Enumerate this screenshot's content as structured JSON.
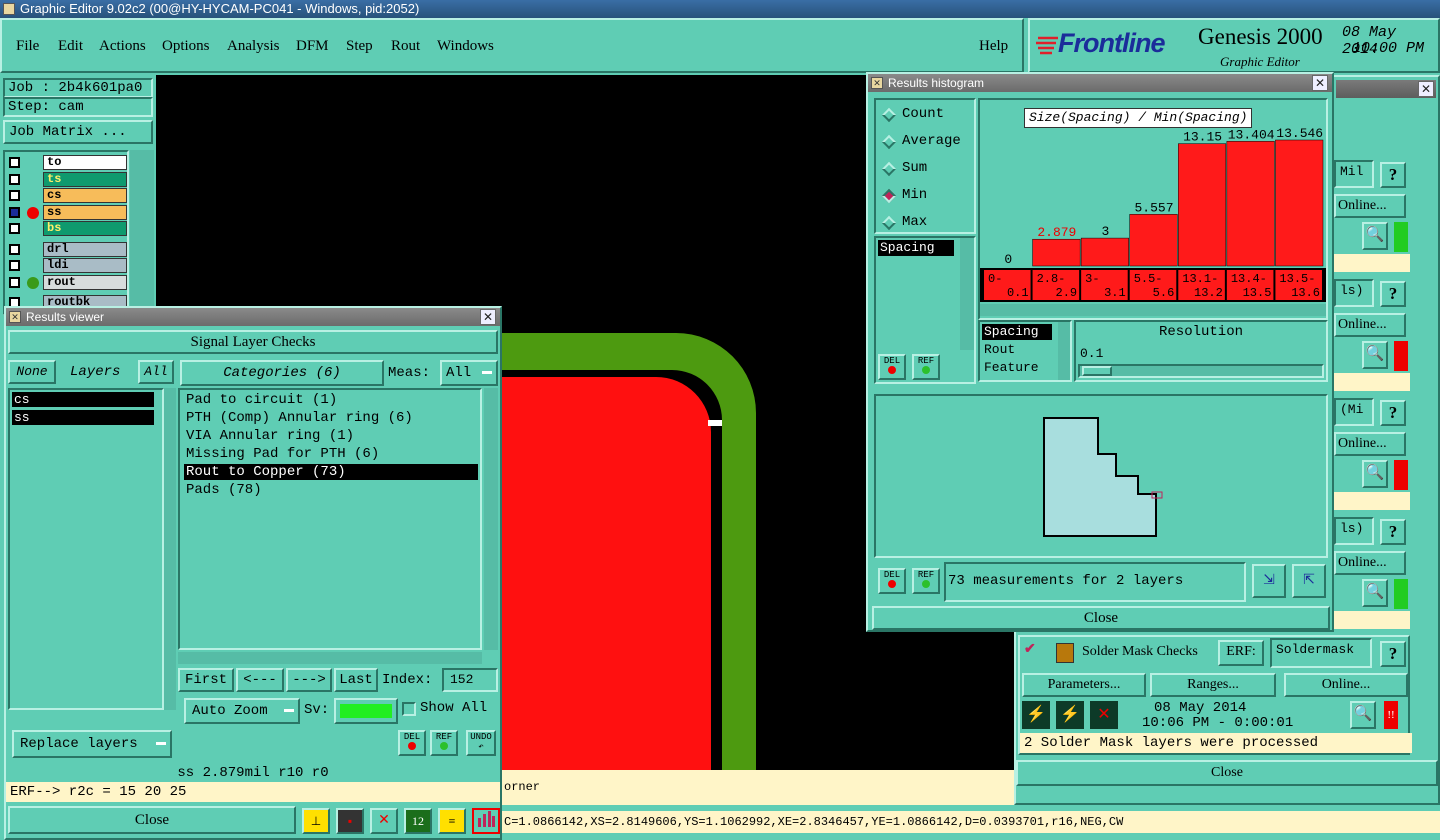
{
  "window_title": "Graphic Editor 9.02c2 (00@HY-HYCAM-PC041 - Windows, pid:2052)",
  "menu": [
    "File",
    "Edit",
    "Actions",
    "Options",
    "Analysis",
    "DFM",
    "Step",
    "Rout",
    "Windows"
  ],
  "help_label": "Help",
  "brand": {
    "logo": "Frontline",
    "product": "Genesis 2000",
    "subtitle": "Graphic Editor",
    "date": "08 May 2014",
    "time": "10:00 PM"
  },
  "job": {
    "job_label": "Job : 2b4k601pa0",
    "step_label": "Step: cam",
    "matrix_button": "Job Matrix ..."
  },
  "layers": [
    {
      "name": "to",
      "color": "#ffffff"
    },
    {
      "name": "ts",
      "color": "#0f9a6e"
    },
    {
      "name": "cs",
      "color": "#f7bc5a"
    },
    {
      "name": "ss",
      "color": "#f7bc5a"
    },
    {
      "name": "bs",
      "color": "#0f9a6e"
    },
    {
      "name": "drl",
      "color": "#a9bcc6"
    },
    {
      "name": "ldi",
      "color": "#a9bcc6"
    },
    {
      "name": "rout",
      "color": "#d7dcdc"
    },
    {
      "name": "routbk",
      "color": "#a9bcc6"
    }
  ],
  "results_viewer": {
    "title": "Results viewer",
    "header": "Signal Layer Checks",
    "none_label": "None",
    "layers_label": "Layers",
    "all_label": "All",
    "categories_label": "Categories (6)",
    "meas_label": "Meas:",
    "meas_value": "All",
    "layer_list": [
      "cs",
      "ss"
    ],
    "categories": [
      "Pad to circuit (1)",
      "PTH (Comp) Annular ring (6)",
      "VIA Annular ring (1)",
      "Missing Pad for PTH (6)",
      "Rout to Copper (73)",
      "Pads (78)"
    ],
    "nav": {
      "first": "First",
      "prev": "<---",
      "next": "--->",
      "last": "Last",
      "index_label": "Index:",
      "index_value": "152"
    },
    "auto_zoom": "Auto Zoom",
    "sv_label": "Sv:",
    "show_all": "Show All",
    "replace_layers": "Replace layers",
    "del": "DEL",
    "ref": "REF",
    "undo": "UNDO",
    "status": "ss 2.879mil  r10  r0",
    "erf": "ERF--> r2c = 15 20 25",
    "close": "Close"
  },
  "histogram": {
    "title": "Results histogram",
    "options": [
      "Count",
      "Average",
      "Sum",
      "Min",
      "Max"
    ],
    "selected_option": "Min",
    "spacing_list": [
      "Spacing"
    ],
    "list2": [
      "Spacing",
      "Rout",
      "Feature"
    ],
    "resolution_label": "Resolution",
    "resolution_value": "0.1",
    "measurements": "73 measurements for 2 layers",
    "close": "Close",
    "del": "DEL",
    "ref": "REF"
  },
  "chart_data": {
    "type": "bar",
    "title": "Size(Spacing) / Min(Spacing)",
    "categories": [
      "0-0.1",
      "2.8-2.9",
      "3-3.1",
      "5.5-5.6",
      "13.1-13.2",
      "13.4-13.5",
      "13.5-13.6"
    ],
    "category_lines": [
      [
        "0-",
        "0.1"
      ],
      [
        "2.8-",
        "2.9"
      ],
      [
        "3-",
        "3.1"
      ],
      [
        "5.5-",
        "5.6"
      ],
      [
        "13.1-",
        "13.2"
      ],
      [
        "13.4-",
        "13.5"
      ],
      [
        "13.5-",
        "13.6"
      ]
    ],
    "values": [
      0,
      2.879,
      3,
      5.557,
      13.15,
      13.404,
      13.546
    ],
    "value_labels": [
      "0",
      "2.879",
      "3",
      "5.557",
      "13.15",
      "13.404",
      "13.546"
    ],
    "highlight_index": 1,
    "ylim": [
      0,
      13.546
    ],
    "bar_color": "#ff1a1a",
    "grid": false
  },
  "right_panel": {
    "snippets": [
      "Mil",
      "ls)",
      "(Mi",
      "ls)"
    ],
    "online": "Online...",
    "solder_mask": {
      "title": "Solder Mask Checks",
      "erf_label": "ERF:",
      "erf_value": "Soldermask",
      "parameters": "Parameters...",
      "ranges": "Ranges...",
      "online": "Online...",
      "date": "08 May 2014",
      "time": "10:06 PM - 0:00:01",
      "message": "2 Solder Mask layers were processed",
      "close": "Close",
      "help": "?"
    }
  },
  "canvas_text": "orner",
  "status_line": "C=1.0866142,XS=2.8149606,YS=1.1062992,XE=2.8346457,YE=1.0866142,D=0.0393701,r16,NEG,CW",
  "colors": {
    "bg": "#5fcdb4",
    "copper": "#ff1010",
    "rout": "#4d9a10",
    "canvas": "#000000"
  }
}
